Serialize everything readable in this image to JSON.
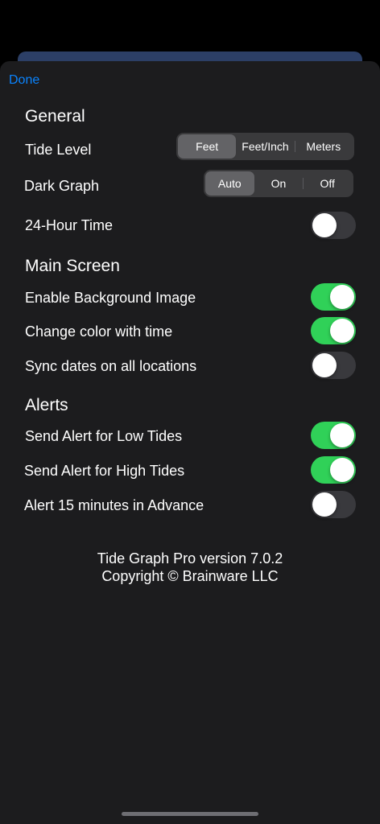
{
  "nav": {
    "done_label": "Done"
  },
  "sections": {
    "general": {
      "title": "General",
      "tide_level": {
        "label": "Tide Level",
        "options": [
          "Feet",
          "Feet/Inch",
          "Meters"
        ],
        "selected": "Feet"
      },
      "dark_graph": {
        "label": "Dark Graph",
        "options": [
          "Auto",
          "On",
          "Off"
        ],
        "selected": "Auto"
      },
      "hour24": {
        "label": "24-Hour Time",
        "on": false
      }
    },
    "main_screen": {
      "title": "Main Screen",
      "bg_image": {
        "label": "Enable Background Image",
        "on": true
      },
      "color_time": {
        "label": "Change color with time",
        "on": true
      },
      "sync_dates": {
        "label": "Sync dates on all locations",
        "on": false
      }
    },
    "alerts": {
      "title": "Alerts",
      "low_tides": {
        "label": "Send Alert for Low Tides",
        "on": true
      },
      "high_tides": {
        "label": "Send Alert for High Tides",
        "on": true
      },
      "advance": {
        "label": "Alert 15 minutes in Advance",
        "on": false
      }
    }
  },
  "footer": {
    "version": "Tide Graph Pro version 7.0.2",
    "copyright": "Copyright © Brainware LLC"
  },
  "colors": {
    "accent": "#0a84ff",
    "toggle_on": "#30d158",
    "sheet_bg": "#1c1c1e"
  }
}
